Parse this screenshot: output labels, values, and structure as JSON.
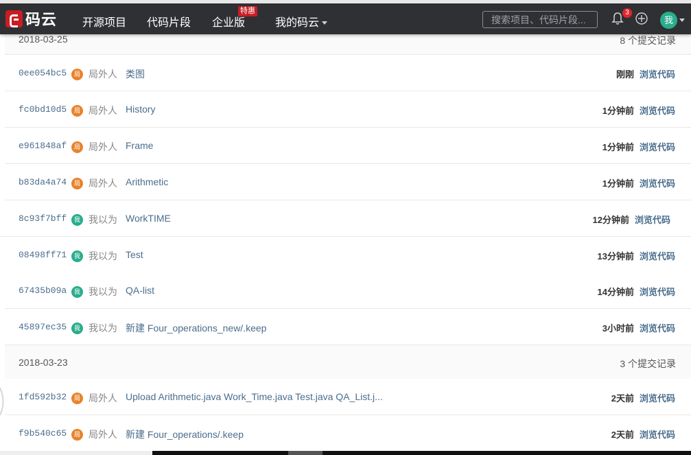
{
  "header": {
    "logo_text": "码云",
    "nav": [
      {
        "label": "开源项目"
      },
      {
        "label": "代码片段"
      },
      {
        "label": "企业版",
        "badge": "特惠"
      },
      {
        "label": "我的码云"
      }
    ],
    "search_placeholder": "搜索项目、代码片段...",
    "notification_count": "3",
    "user_avatar_label": "我",
    "icons": [
      "bell-icon",
      "plus-circle-icon",
      "chevron-down-icon"
    ]
  },
  "colors": {
    "nav_bg": "#2f3033",
    "brand_red": "#c71d23",
    "link_blue": "#4a6d8c",
    "avatar_orange": "#e8832c",
    "avatar_green": "#29ad8d"
  },
  "groups": [
    {
      "date": "2018-03-25",
      "count": "8 个提交记录",
      "commits": [
        {
          "sha": "0ee054bc5",
          "avatar": "局",
          "author": "局外人",
          "message": "类图",
          "time": "刚刚",
          "browse": "浏览代码"
        },
        {
          "sha": "fc0bd10d5",
          "avatar": "局",
          "author": "局外人",
          "message": "History",
          "time": "1分钟前",
          "browse": "浏览代码"
        },
        {
          "sha": "e961848af",
          "avatar": "局",
          "author": "局外人",
          "message": "Frame",
          "time": "1分钟前",
          "browse": "浏览代码"
        },
        {
          "sha": "b83da4a74",
          "avatar": "局",
          "author": "局外人",
          "message": "Arithmetic",
          "time": "1分钟前",
          "browse": "浏览代码"
        },
        {
          "sha": "8c93f7bff",
          "avatar": "我",
          "author": "我以为",
          "message": "WorkTIME",
          "time": "12分钟前",
          "browse": "浏览代码"
        },
        {
          "sha": "08498ff71",
          "avatar": "我",
          "author": "我以为",
          "message": "Test",
          "time": "13分钟前",
          "browse": "浏览代码"
        },
        {
          "sha": "67435b09a",
          "avatar": "我",
          "author": "我以为",
          "message": "QA-list",
          "time": "14分钟前",
          "browse": "浏览代码"
        },
        {
          "sha": "45897ec35",
          "avatar": "我",
          "author": "我以为",
          "message": "新建 Four_operations_new/.keep",
          "time": "3小时前",
          "browse": "浏览代码"
        }
      ]
    },
    {
      "date": "2018-03-23",
      "count": "3 个提交记录",
      "commits": [
        {
          "sha": "1fd592b32",
          "avatar": "局",
          "author": "局外人",
          "message": "Upload Arithmetic.java Work_Time.java Test.java QA_List.j...",
          "time": "2天前",
          "browse": "浏览代码"
        },
        {
          "sha": "f9b540c65",
          "avatar": "局",
          "author": "局外人",
          "message": "新建 Four_operations/.keep",
          "time": "2天前",
          "browse": "浏览代码"
        }
      ]
    }
  ]
}
